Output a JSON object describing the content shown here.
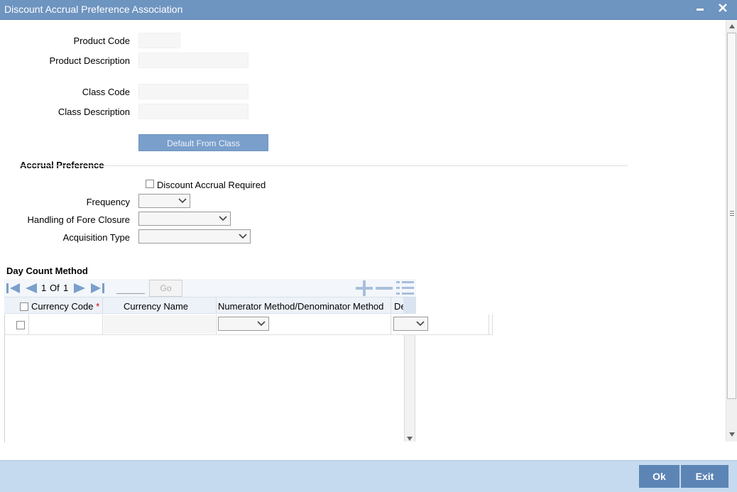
{
  "window": {
    "title": "Discount Accrual Preference Association",
    "minimize_glyph": "▬",
    "close_glyph": "✕"
  },
  "form": {
    "product_code_label": "Product Code",
    "product_description_label": "Product Description",
    "class_code_label": "Class Code",
    "class_description_label": "Class Description",
    "default_from_class_button": "Default From Class"
  },
  "accrual_preference": {
    "section_title": "Accrual Preference",
    "discount_accrual_required_label": "Discount Accrual Required",
    "frequency_label": "Frequency",
    "handling_label": "Handling of Fore Closure",
    "acquisition_type_label": "Acquisition Type"
  },
  "day_count": {
    "section_title": "Day Count Method",
    "pager": {
      "current": "1",
      "of_label": "Of",
      "total": "1",
      "go_label": "Go"
    },
    "columns": [
      "Currency Code",
      "Currency Name",
      "Numerator Method/Denominator Method",
      "De"
    ],
    "required_marker": "*"
  },
  "footer": {
    "ok_label": "Ok",
    "exit_label": "Exit"
  },
  "colors": {
    "title_bar": "#6e94c0",
    "footer_bar": "#c5daee",
    "footer_button": "#5c85b5",
    "nav_icon": "#7a9fcb"
  }
}
